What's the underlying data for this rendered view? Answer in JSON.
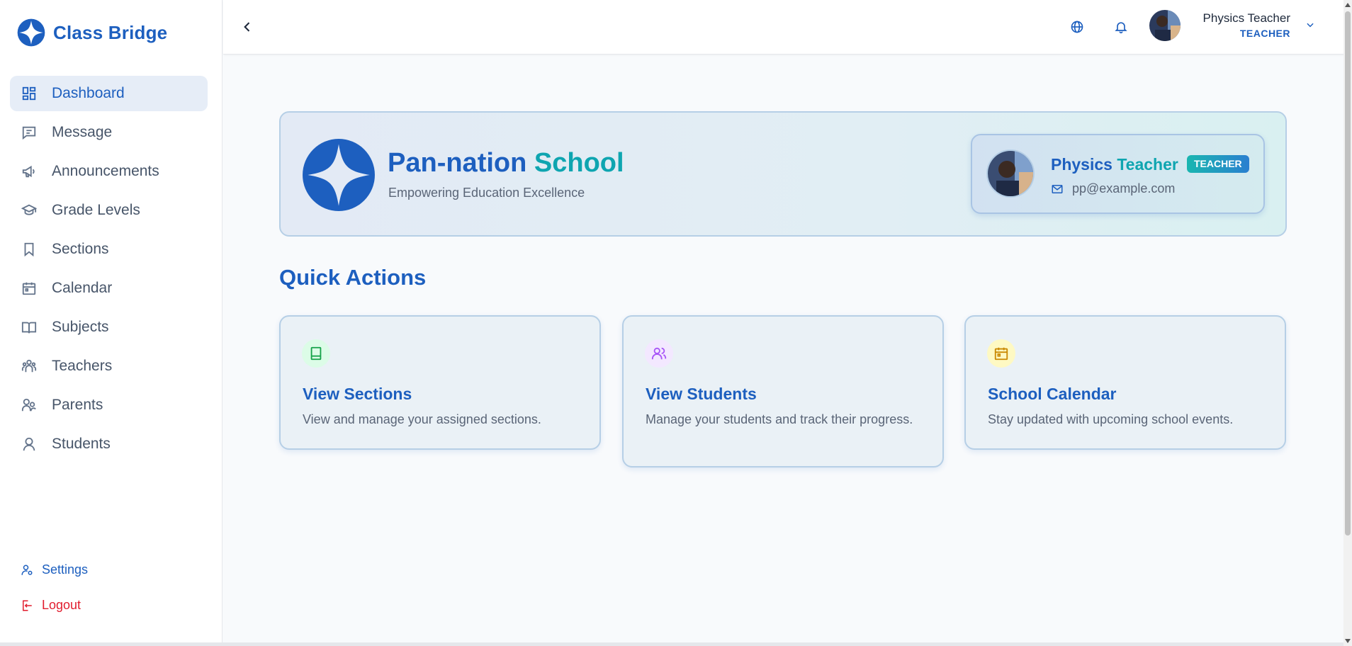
{
  "app": {
    "name": "Class Bridge"
  },
  "sidebar": {
    "items": [
      {
        "label": "Dashboard",
        "icon": "dashboard-icon",
        "active": true
      },
      {
        "label": "Message",
        "icon": "message-icon"
      },
      {
        "label": "Announcements",
        "icon": "megaphone-icon"
      },
      {
        "label": "Grade Levels",
        "icon": "graduation-cap-icon"
      },
      {
        "label": "Sections",
        "icon": "bookmark-icon"
      },
      {
        "label": "Calendar",
        "icon": "calendar-icon"
      },
      {
        "label": "Subjects",
        "icon": "book-open-icon"
      },
      {
        "label": "Teachers",
        "icon": "teachers-icon"
      },
      {
        "label": "Parents",
        "icon": "parents-icon"
      },
      {
        "label": "Students",
        "icon": "student-icon"
      }
    ],
    "settings_label": "Settings",
    "logout_label": "Logout"
  },
  "header": {
    "user_name": "Physics Teacher",
    "user_role": "TEACHER"
  },
  "hero": {
    "school_name_part1": "Pan-nation",
    "school_name_part2": "School",
    "tagline": "Empowering Education Excellence",
    "profile": {
      "name_part1": "Physics",
      "name_part2": "Teacher",
      "role_badge": "TEACHER",
      "email": "pp@example.com"
    }
  },
  "quick_actions": {
    "title": "Quick Actions",
    "cards": [
      {
        "title": "View Sections",
        "description": "View and manage your assigned sections.",
        "icon": "book-icon",
        "icon_color": "#16a34a",
        "icon_bg": "#dcfce7"
      },
      {
        "title": "View Students",
        "description": "Manage your students and track their progress.",
        "icon": "users-icon",
        "icon_color": "#a855f7",
        "icon_bg": "#f3e8ff"
      },
      {
        "title": "School Calendar",
        "description": "Stay updated with upcoming school events.",
        "icon": "calendar-icon",
        "icon_color": "#ca8a04",
        "icon_bg": "#fef9c3"
      }
    ]
  },
  "colors": {
    "brand": "#1d5fbf",
    "accent_teal": "#0ea5b0",
    "logout_red": "#e11d2e"
  }
}
